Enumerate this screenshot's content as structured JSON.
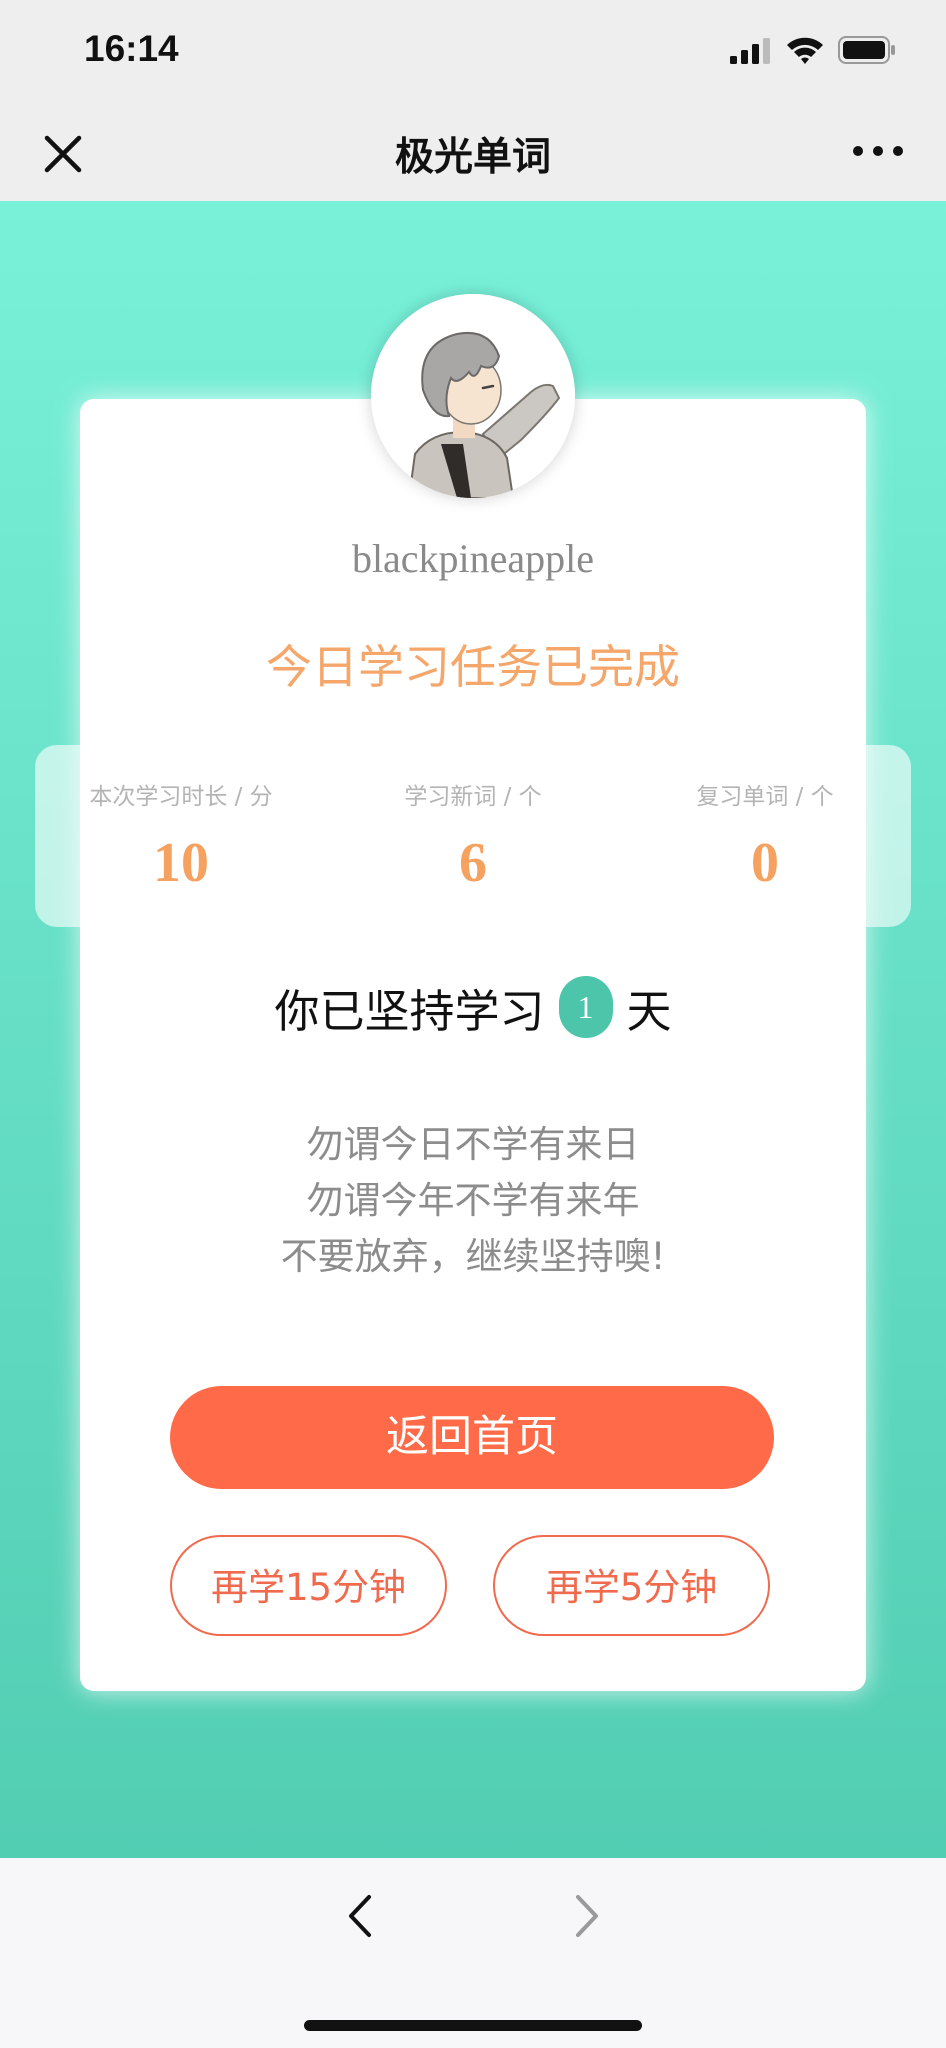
{
  "status_bar": {
    "time": "16:14"
  },
  "nav": {
    "title": "极光单词"
  },
  "profile": {
    "username": "blackpineapple"
  },
  "task": {
    "status_text": "今日学习任务已完成"
  },
  "stats": [
    {
      "label": "本次学习时长 / 分",
      "value": "10"
    },
    {
      "label": "学习新词 / 个",
      "value": "6"
    },
    {
      "label": "复习单词 / 个",
      "value": "0"
    }
  ],
  "streak": {
    "prefix": "你已坚持学习",
    "days": "1",
    "suffix": "天"
  },
  "motto": [
    "勿谓今日不学有来日",
    "勿谓今年不学有来年",
    "不要放弃，继续坚持噢!"
  ],
  "buttons": {
    "home": "返回首页",
    "study_15": "再学15分钟",
    "study_5": "再学5分钟"
  },
  "colors": {
    "accent": "#f5a160",
    "primary_button": "#ff6b48",
    "badge": "#4cc5aa",
    "background_top": "#79f1d9",
    "background_bottom": "#52ceb3"
  }
}
